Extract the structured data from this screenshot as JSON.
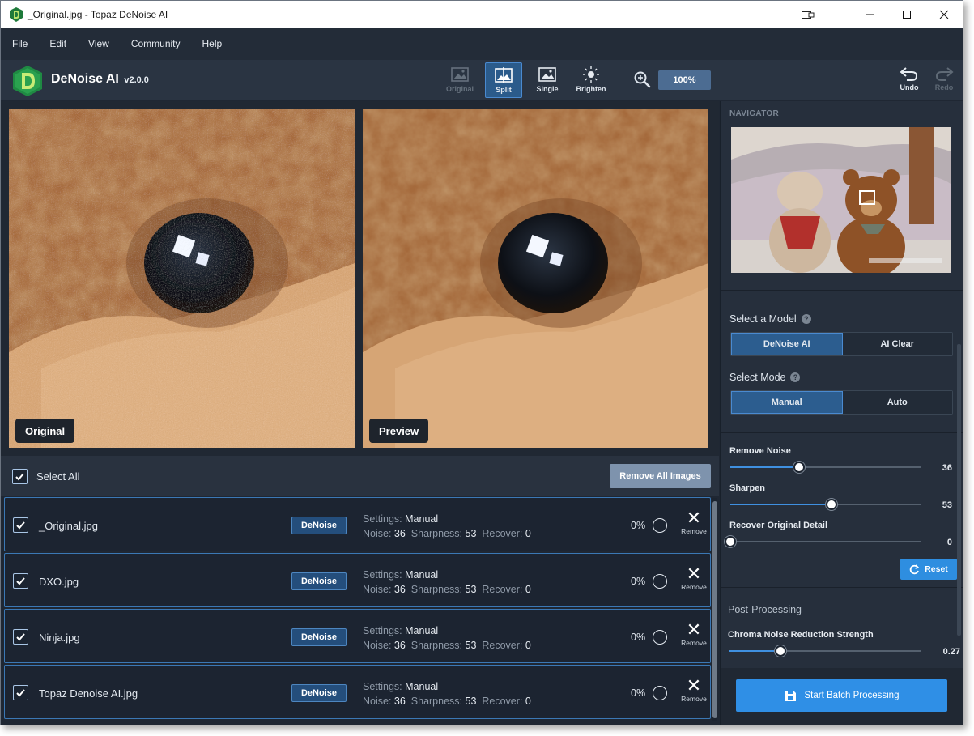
{
  "window": {
    "title": "_Original.jpg - Topaz DeNoise AI",
    "controls": [
      "minimize",
      "maximize",
      "close"
    ]
  },
  "menu": [
    "File",
    "Edit",
    "View",
    "Community",
    "Help"
  ],
  "toolbar": {
    "app_name": "DeNoise AI",
    "version": "v2.0.0",
    "views": [
      {
        "label": "Original",
        "state": "disabled"
      },
      {
        "label": "Split",
        "state": "active"
      },
      {
        "label": "Single",
        "state": "normal"
      },
      {
        "label": "Brighten",
        "state": "normal"
      }
    ],
    "zoom": "100%",
    "undo": "Undo",
    "redo": "Redo"
  },
  "viewer": {
    "left_label": "Original",
    "right_label": "Preview"
  },
  "batch": {
    "select_all": "Select All",
    "remove_all": "Remove All Images",
    "items": [
      {
        "name": "_Original.jpg",
        "tag": "DeNoise",
        "settings_label": "Settings:",
        "settings_value": "Manual",
        "noise_label": "Noise:",
        "noise": "36",
        "sharp_label": "Sharpness:",
        "sharpness": "53",
        "recover_label": "Recover:",
        "recover": "0",
        "progress": "0%",
        "remove": "Remove"
      },
      {
        "name": "DXO.jpg",
        "tag": "DeNoise",
        "settings_label": "Settings:",
        "settings_value": "Manual",
        "noise_label": "Noise:",
        "noise": "36",
        "sharp_label": "Sharpness:",
        "sharpness": "53",
        "recover_label": "Recover:",
        "recover": "0",
        "progress": "0%",
        "remove": "Remove"
      },
      {
        "name": "Ninja.jpg",
        "tag": "DeNoise",
        "settings_label": "Settings:",
        "settings_value": "Manual",
        "noise_label": "Noise:",
        "noise": "36",
        "sharp_label": "Sharpness:",
        "sharpness": "53",
        "recover_label": "Recover:",
        "recover": "0",
        "progress": "0%",
        "remove": "Remove"
      },
      {
        "name": "Topaz Denoise AI.jpg",
        "tag": "DeNoise",
        "settings_label": "Settings:",
        "settings_value": "Manual",
        "noise_label": "Noise:",
        "noise": "36",
        "sharp_label": "Sharpness:",
        "sharpness": "53",
        "recover_label": "Recover:",
        "recover": "0",
        "progress": "0%",
        "remove": "Remove"
      }
    ]
  },
  "panel": {
    "navigator": "NAVIGATOR",
    "model_label": "Select a Model",
    "models": [
      "DeNoise AI",
      "AI Clear"
    ],
    "selected_model": "DeNoise AI",
    "mode_label": "Select Mode",
    "modes": [
      "Manual",
      "Auto"
    ],
    "selected_mode": "Manual",
    "sliders": [
      {
        "label": "Remove Noise",
        "value": "36",
        "fraction": 0.36
      },
      {
        "label": "Sharpen",
        "value": "53",
        "fraction": 0.53
      },
      {
        "label": "Recover Original Detail",
        "value": "0",
        "fraction": 0.0
      }
    ],
    "reset": "Reset",
    "post_processing": "Post-Processing",
    "chroma": {
      "label": "Chroma Noise Reduction Strength",
      "value": "0.27",
      "fraction": 0.27
    },
    "start": "Start Batch Processing"
  },
  "colors": {
    "accent": "#2f8fe6",
    "active_tab": "#2b5b8b",
    "background": "#1f2733"
  }
}
